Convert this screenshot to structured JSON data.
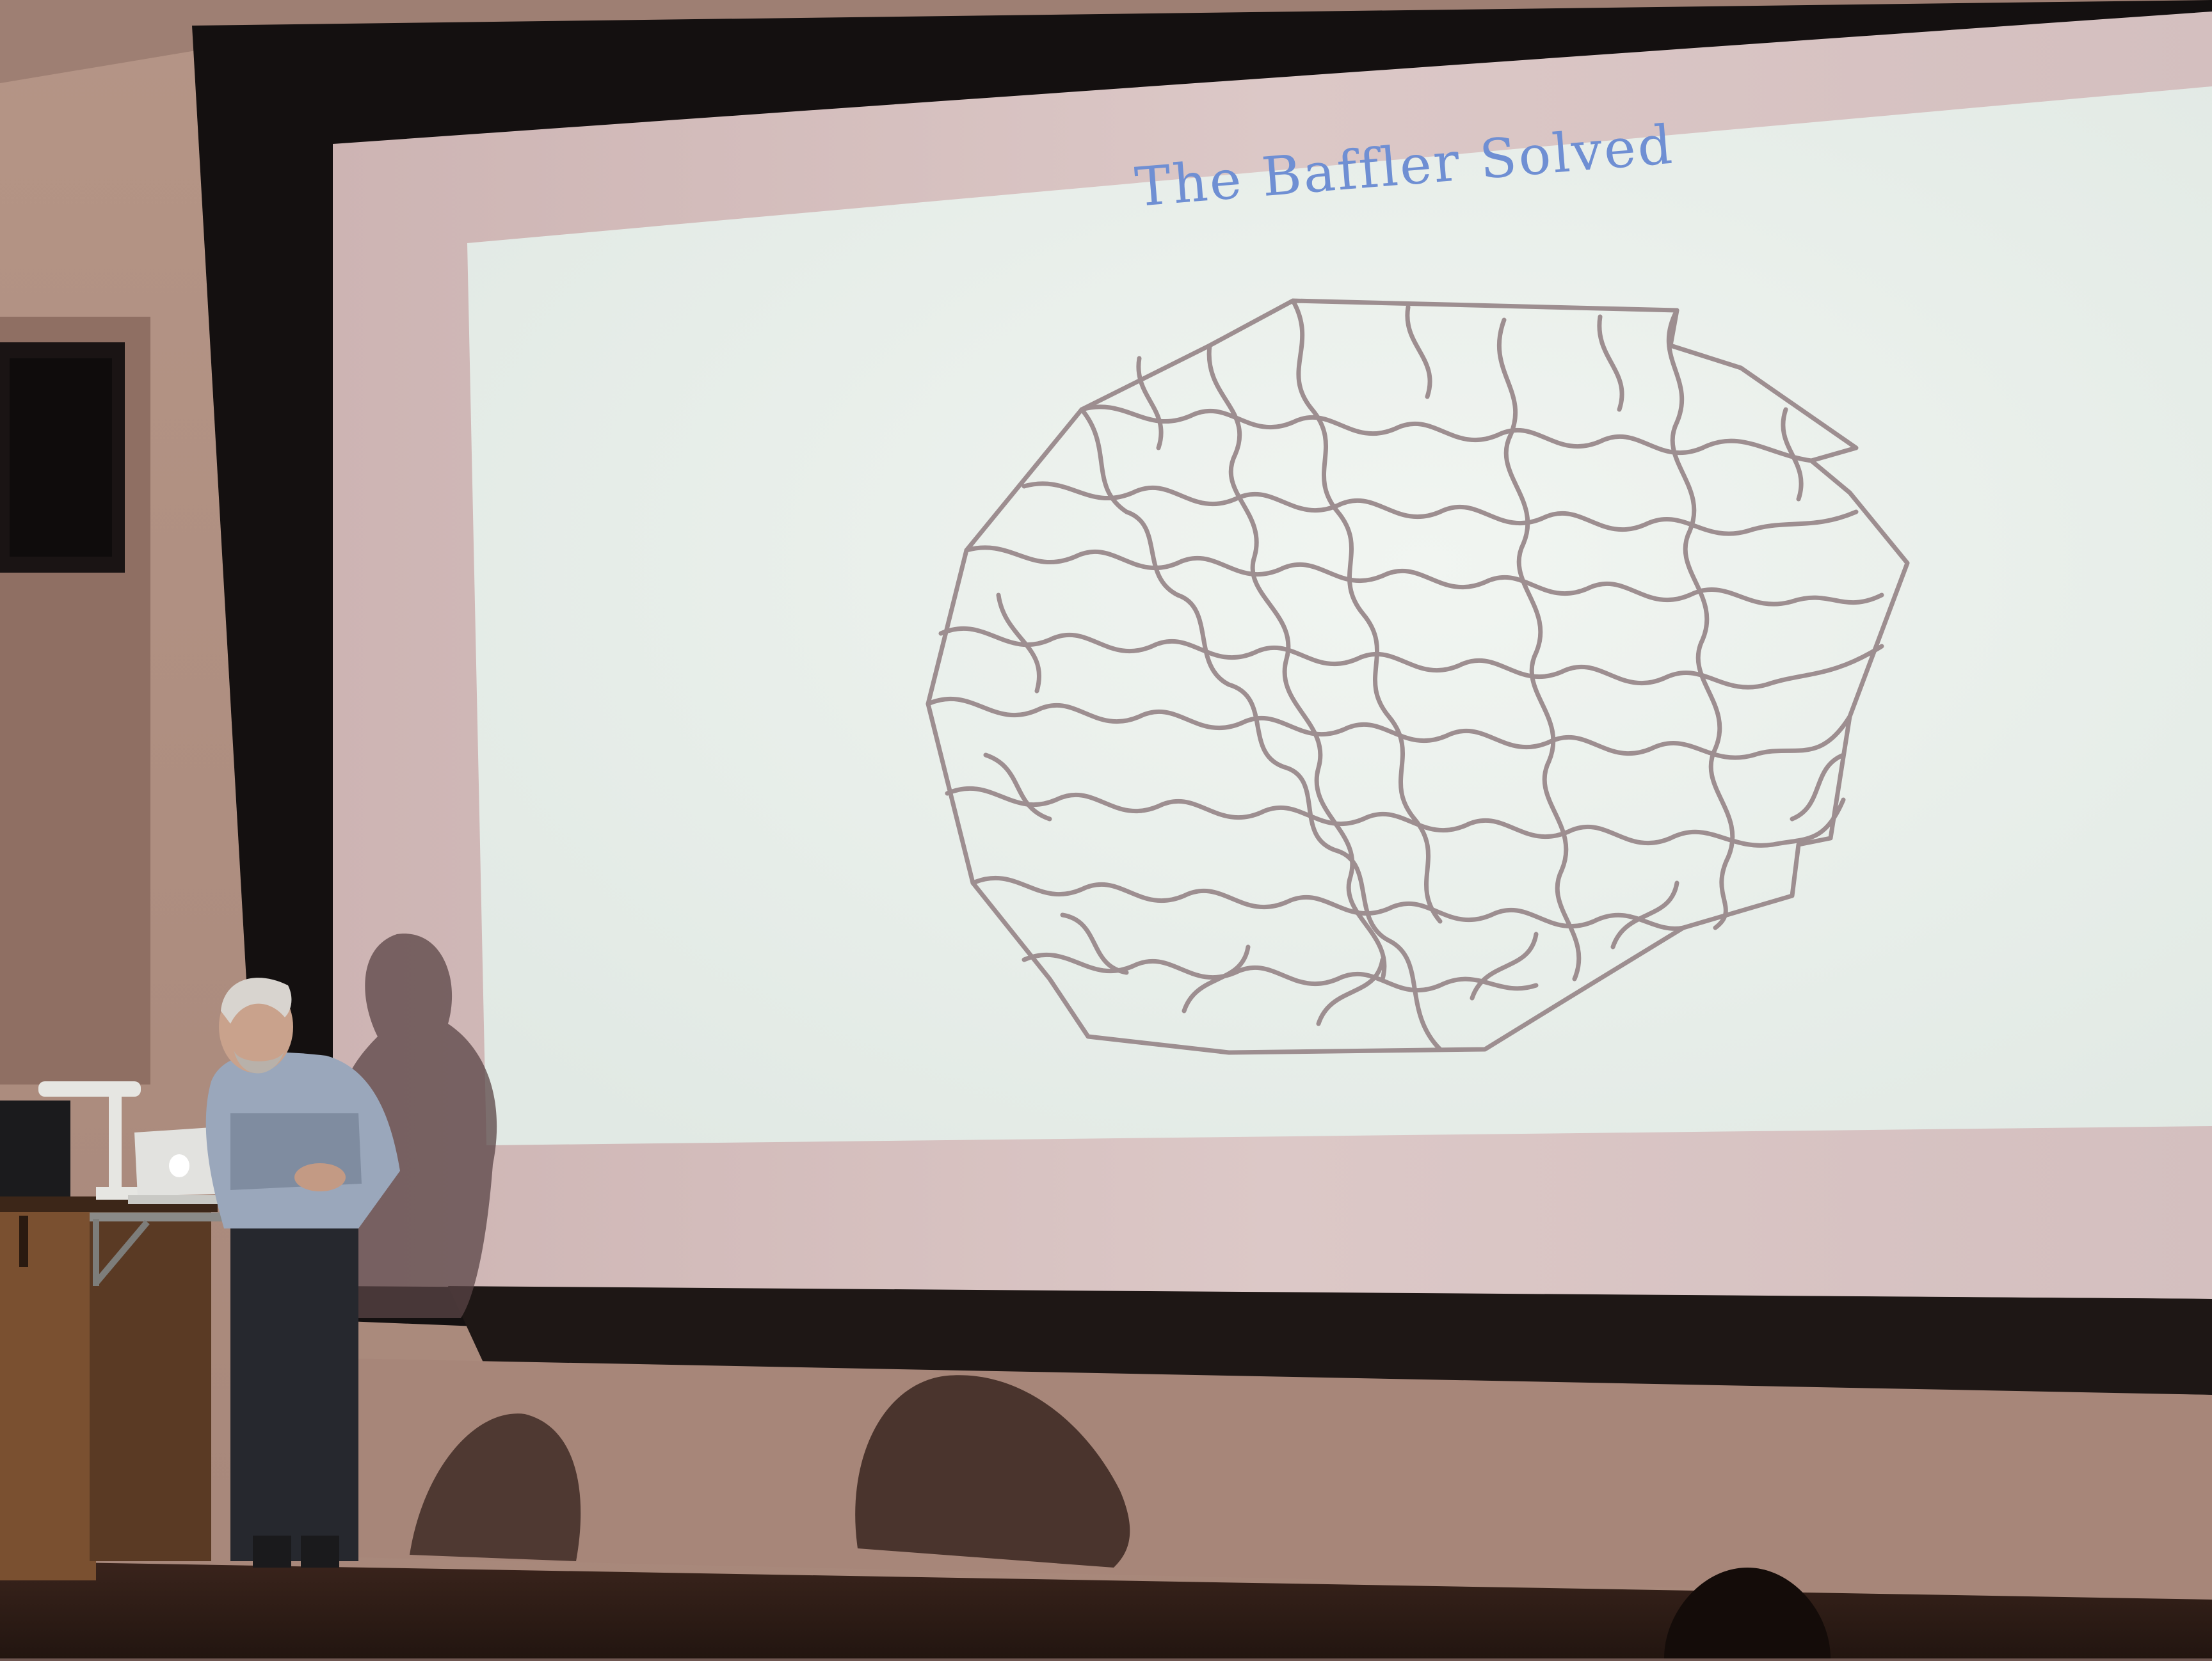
{
  "slide": {
    "title": "The Baffler Solved",
    "title_color": "#6f8fd3"
  },
  "colors": {
    "wall": "#c9ab9c",
    "screen": "#d8c6c6",
    "slide_background": "#e9efeb",
    "puzzle_lines": "#9a8a8c",
    "stage_floor": "#2d1c16"
  }
}
